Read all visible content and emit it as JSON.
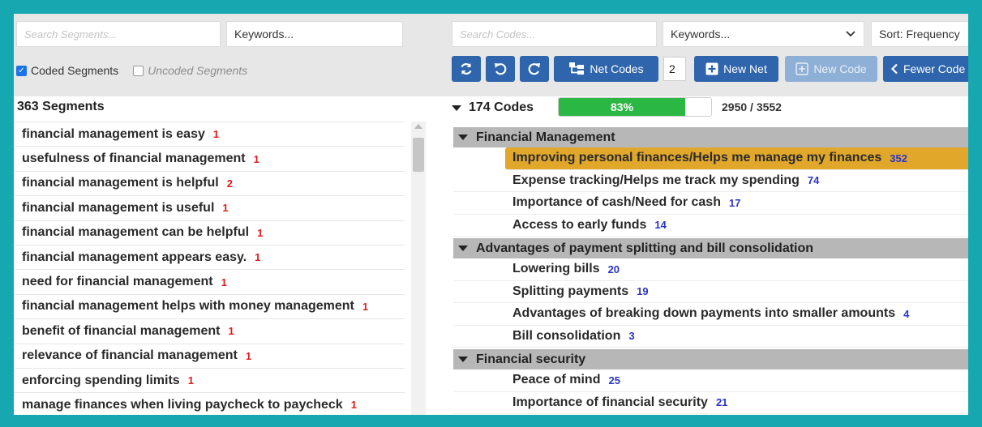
{
  "segments_panel": {
    "search_placeholder": "Search Segments...",
    "keywords_label": "Keywords...",
    "coded_label": "Coded Segments",
    "coded_checked": true,
    "uncoded_label": "Uncoded Segments",
    "uncoded_checked": false,
    "count_label": "363 Segments",
    "items": [
      {
        "text": "financial management is easy",
        "count": "1"
      },
      {
        "text": "usefulness of financial management",
        "count": "1"
      },
      {
        "text": "financial management is helpful",
        "count": "2"
      },
      {
        "text": "financial management is useful",
        "count": "1"
      },
      {
        "text": "financial management can be helpful",
        "count": "1"
      },
      {
        "text": "financial management appears easy.",
        "count": "1"
      },
      {
        "text": "need for financial management",
        "count": "1"
      },
      {
        "text": "financial management helps with money management",
        "count": "1"
      },
      {
        "text": "benefit of financial management",
        "count": "1"
      },
      {
        "text": "relevance of financial management",
        "count": "1"
      },
      {
        "text": "enforcing spending limits",
        "count": "1"
      },
      {
        "text": "manage finances when living paycheck to paycheck",
        "count": "1"
      }
    ]
  },
  "codes_panel": {
    "search_placeholder": "Search Codes...",
    "keywords_label": "Keywords...",
    "sort_label": "Sort: Frequency",
    "toolbar": {
      "refresh_icon": "refresh-icon",
      "undo_icon": "undo-icon",
      "redo_icon": "redo-icon",
      "net_codes_label": "Net Codes",
      "net_level": "2",
      "new_net_label": "New Net",
      "new_code_label": "New Code",
      "fewer_codes_label": "Fewer Code"
    },
    "count_label": "174 Codes",
    "progress_label": "83%",
    "progress_fraction": 0.83,
    "progress_text": "2950 / 3552",
    "highlight_color": "#e0a72b",
    "groups": [
      {
        "title": "Financial Management",
        "codes": [
          {
            "text": "Improving personal finances/Helps me manage my finances",
            "count": "352",
            "highlighted": true
          },
          {
            "text": "Expense tracking/Helps me track my spending",
            "count": "74"
          },
          {
            "text": "Importance of cash/Need for cash",
            "count": "17"
          },
          {
            "text": "Access to early funds",
            "count": "14"
          }
        ]
      },
      {
        "title": "Advantages of payment splitting and bill consolidation",
        "codes": [
          {
            "text": "Lowering bills",
            "count": "20"
          },
          {
            "text": "Splitting payments",
            "count": "19"
          },
          {
            "text": "Advantages of breaking down payments into smaller amounts",
            "count": "4"
          },
          {
            "text": "Bill consolidation",
            "count": "3"
          }
        ]
      },
      {
        "title": "Financial security",
        "codes": [
          {
            "text": "Peace of mind",
            "count": "25"
          },
          {
            "text": "Importance of financial security",
            "count": "21"
          }
        ]
      }
    ]
  }
}
